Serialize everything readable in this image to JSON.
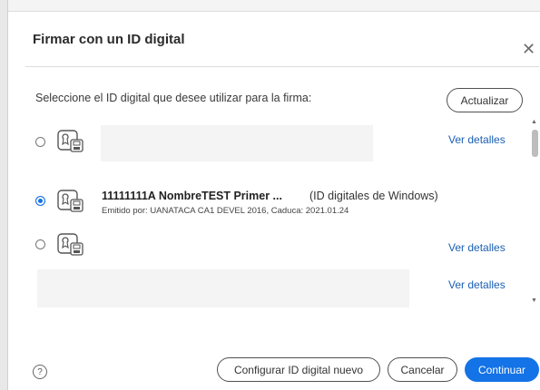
{
  "dialog": {
    "title": "Firmar con un ID digital",
    "close_icon": "close-icon",
    "instruction": "Seleccione el ID digital que desee utilizar para la firma:",
    "refresh_label": "Actualizar"
  },
  "ids": [
    {
      "selected": false,
      "details_label": "Ver detalles"
    },
    {
      "selected": true,
      "name": "11111111A NombreTEST Primer ...",
      "type": "(ID digitales de Windows)",
      "issuer": "Emitido por: UANATACA CA1 DEVEL 2016, Caduca: 2021.01.24"
    },
    {
      "selected": false,
      "details_label": "Ver detalles"
    },
    {
      "details_label": "Ver detalles"
    }
  ],
  "footer": {
    "help_icon": "help-icon",
    "help_symbol": "?",
    "configure_label": "Configurar ID digital nuevo",
    "cancel_label": "Cancelar",
    "continue_label": "Continuar"
  },
  "colors": {
    "accent": "#1473e6",
    "link": "#1a5fb4"
  }
}
